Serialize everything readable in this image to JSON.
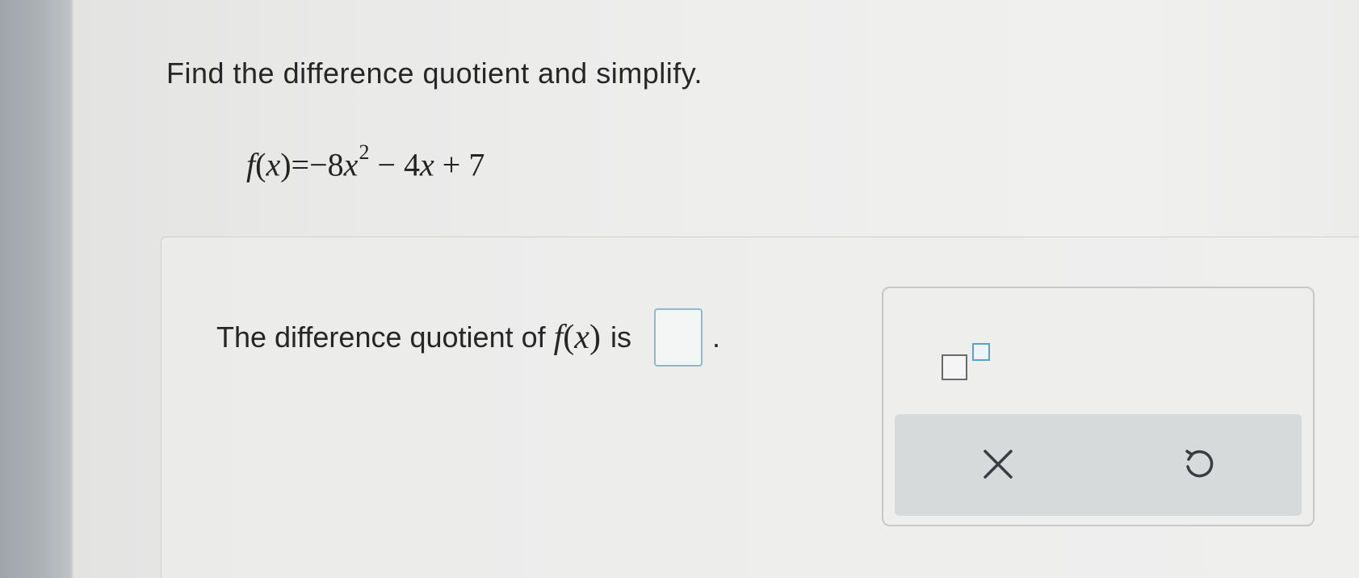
{
  "question": {
    "instruction": "Find the difference quotient and simplify.",
    "function": {
      "name": "f",
      "open_paren": "(",
      "variable": "x",
      "close_paren": ")",
      "equals": "=",
      "term1": "−8",
      "term1_var": "x",
      "exponent": "2",
      "term2": " − 4",
      "term2_var": "x",
      "term3": " + 7"
    }
  },
  "answer": {
    "prompt_before": "The difference quotient of",
    "fn_name": "f",
    "fn_open": "(",
    "fn_var": "x",
    "fn_close": ")",
    "prompt_after": "is",
    "input_value": "",
    "period": "."
  },
  "toolbox": {
    "exponent_template": "exponent-template-icon",
    "clear_icon": "close-icon",
    "undo_icon": "undo-icon"
  },
  "colors": {
    "answer_box_border": "#8fb9c4",
    "exponent_power_border": "#5aa0c8",
    "toolbar_background": "#d7dadb"
  }
}
